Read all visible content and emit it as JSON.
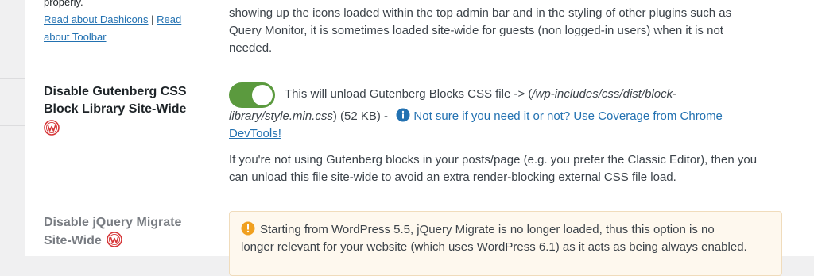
{
  "top_left": {
    "properly_text": "properly.",
    "dashicons_link": "Read about Dashicons",
    "separator": "|",
    "read_link": "Read",
    "toolbar_link": "about Toolbar"
  },
  "top_description": {
    "line1": "showing up the icons loaded within the top admin bar and in the styling of other plugins such as",
    "line2": "Query Monitor, it is sometimes loaded site-wide for guests (non logged-in users) when it is not",
    "line3": "needed."
  },
  "gutenberg": {
    "label_line1": "Disable Gutenberg CSS",
    "label_line2": "Block Library Site-Wide",
    "toggle_on": true,
    "line1_prefix": "This will unload Gutenberg Blocks CSS file -> (",
    "path_part1": "/wp-includes/css/dist/block-",
    "path_part2": "library/style.min.css",
    "size_text": ") (52 KB) -",
    "coverage_link_line1": "Not sure if you need it or not? Use Coverage from Chrome",
    "coverage_link_line2": "DevTools!",
    "detail_line1": "If you're not using Gutenberg blocks in your posts/page (e.g. you prefer the Classic Editor), then you",
    "detail_line2": "can unload this file site-wide to avoid an extra render-blocking external CSS file load."
  },
  "jquery": {
    "label_line1": "Disable jQuery Migrate",
    "label_line2": "Site-Wide",
    "notice_line1": "Starting from WordPress 5.5, jQuery Migrate is no longer loaded, thus this option is no",
    "notice_line2": "longer relevant for your website (which uses WordPress 6.1) as it acts as being always enabled."
  },
  "colors": {
    "toggle_on": "#5b9a3e",
    "link": "#2271b1",
    "wp_logo": "#d63638",
    "warning": "#f0a020",
    "notice_bg": "#fef8ee"
  }
}
